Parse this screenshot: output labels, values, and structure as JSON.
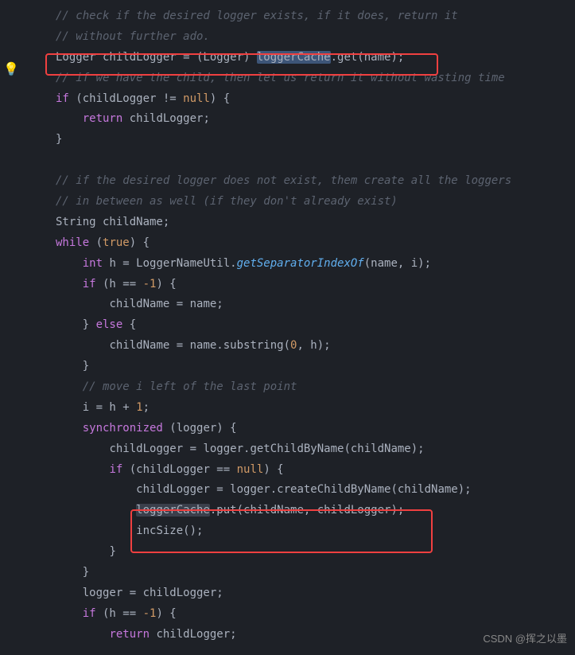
{
  "lines": {
    "c1": "// check if the desired logger exists, if it does, return it",
    "c2": "// without further ado.",
    "l3_logger": "Logger childLogger = (Logger) ",
    "l3_cache": "loggerCache",
    "l3_get": ".get(name);",
    "c4": "// if we have the child, then let us return it without wasting time",
    "l5_if": "if",
    "l5_cond": " (childLogger != ",
    "l5_null": "null",
    "l5_end": ") {",
    "l6_return": "return",
    "l6_val": " childLogger;",
    "l7": "}",
    "c8": "// if the desired logger does not exist, them create all the loggers",
    "c9": "// in between as well (if they don't already exist)",
    "l10": "String childName;",
    "l11_while": "while",
    "l11_paren": " (",
    "l11_true": "true",
    "l11_end": ") {",
    "l12_int": "int",
    "l12_var": " h = LoggerNameUtil.",
    "l12_method": "getSeparatorIndexOf",
    "l12_args": "(name, i);",
    "l13_if": "if",
    "l13_cond": " (h == ",
    "l13_neg": "-1",
    "l13_end": ") {",
    "l14": "childName = name;",
    "l15_close": "} ",
    "l15_else": "else",
    "l15_open": " {",
    "l16_assign": "childName = name.substring(",
    "l16_zero": "0",
    "l16_end": ", h);",
    "l17": "}",
    "c18": "// move i left of the last point",
    "l19_assign": "i = h + ",
    "l19_one": "1",
    "l19_semi": ";",
    "l20_sync": "synchronized",
    "l20_args": " (logger) {",
    "l21": "childLogger = logger.getChildByName(childName);",
    "l22_if": "if",
    "l22_cond": " (childLogger == ",
    "l22_null": "null",
    "l22_end": ") {",
    "l23": "childLogger = logger.createChildByName(childName);",
    "l24_cache": "loggerCache",
    "l24_put": ".put(childName, childLogger);",
    "l25": "incSize();",
    "l26": "}",
    "l27": "}",
    "l28": "logger = childLogger;",
    "l29_if": "if",
    "l29_cond": " (h == ",
    "l29_neg": "-1",
    "l29_end": ") {",
    "l30_return": "return",
    "l30_val": " childLogger;"
  },
  "watermark": "CSDN @挥之以墨"
}
